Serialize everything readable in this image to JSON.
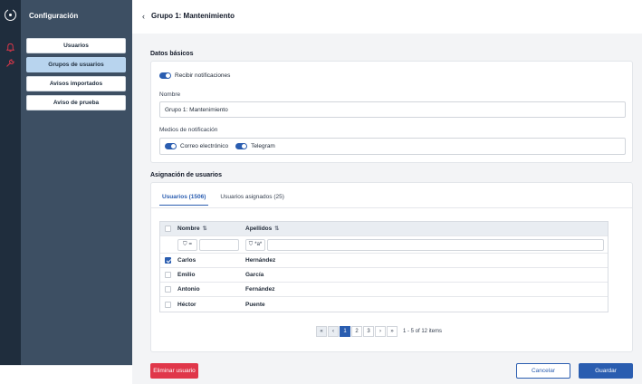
{
  "sidebar": {
    "title": "Configuración",
    "items": [
      {
        "label": "Usuarios"
      },
      {
        "label": "Grupos de usuarios"
      },
      {
        "label": "Avisos importados"
      },
      {
        "label": "Aviso de prueba"
      }
    ]
  },
  "header": {
    "title": "Grupo 1: Mantenimiento"
  },
  "basic": {
    "title": "Datos básicos",
    "notify_label": "Recibir notificaciones",
    "name_label": "Nombre",
    "name_value": "Grupo 1: Mantenimiento",
    "channels_label": "Medios de notificación",
    "email_label": "Correo electrónico",
    "telegram_label": "Telegram"
  },
  "assign": {
    "title": "Asignación de usuarios",
    "tabs": [
      {
        "label": "Usuarios (1506)"
      },
      {
        "label": "Usuarios asignados (25)"
      }
    ],
    "columns": {
      "name": "Nombre",
      "surname": "Apellidos"
    },
    "filter_ops": {
      "name": "=",
      "surname": "*a*"
    },
    "rows": [
      {
        "name": "Carlos",
        "surname": "Hernández",
        "checked": true
      },
      {
        "name": "Emilio",
        "surname": "García",
        "checked": false
      },
      {
        "name": "Antonio",
        "surname": "Fernández",
        "checked": false
      },
      {
        "name": "Héctor",
        "surname": "Puente",
        "checked": false
      }
    ],
    "pager": {
      "first": "«",
      "prev": "‹",
      "pages": [
        "1",
        "2",
        "3"
      ],
      "next": "›",
      "last": "»",
      "info": "1 - 5 of 12 items"
    }
  },
  "footer": {
    "delete_label": "Eliminar usuario",
    "cancel_label": "Cancelar",
    "save_label": "Guardar"
  },
  "colors": {
    "primary": "#2a5db0",
    "danger": "#e0374a",
    "sidebar": "#3d4f63",
    "rail": "#1f2d3d",
    "active_item": "#b8d4ee"
  }
}
